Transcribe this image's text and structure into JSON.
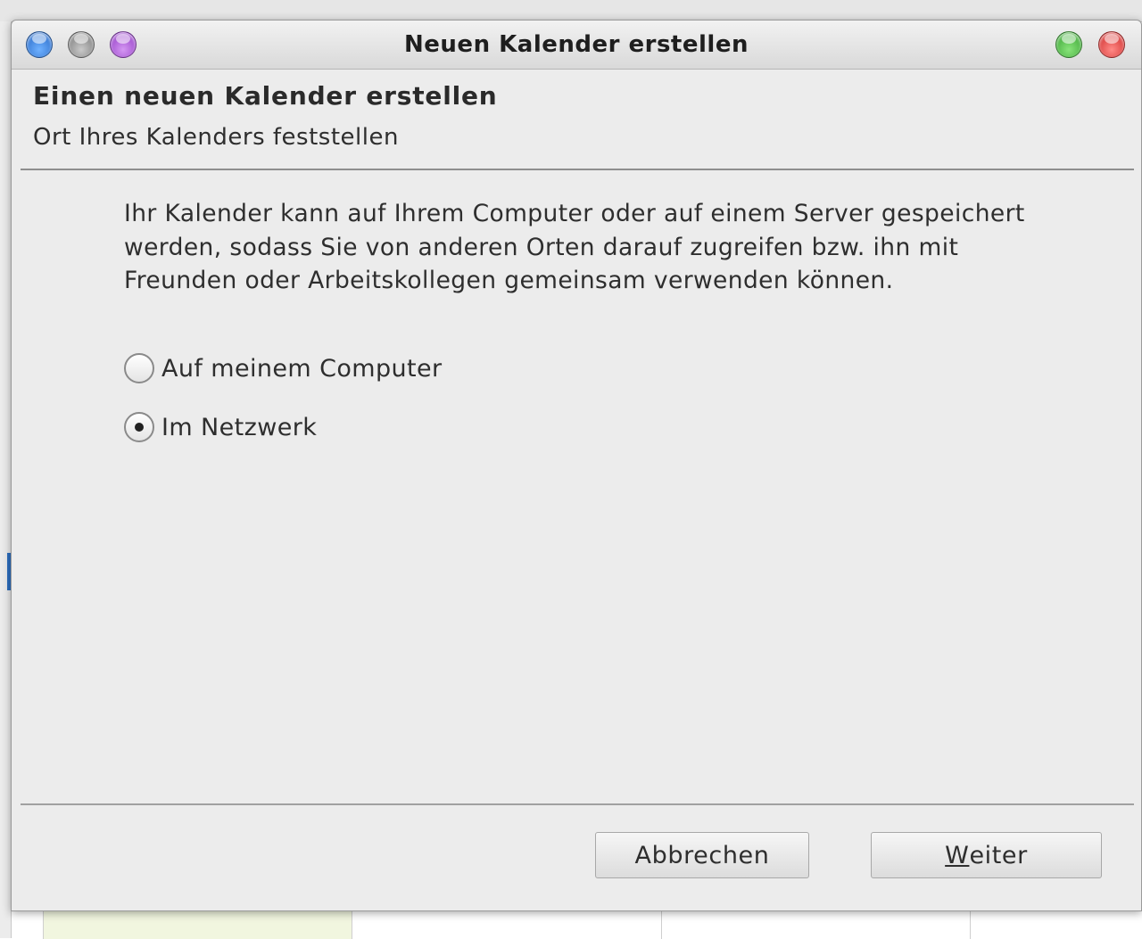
{
  "dialog": {
    "title": "Neuen Kalender erstellen",
    "header_title": "Einen neuen Kalender erstellen",
    "header_subtitle": "Ort Ihres Kalenders feststellen",
    "description": "Ihr Kalender kann auf Ihrem Computer oder auf einem Server gespeichert werden, sodass Sie von anderen Orten darauf zugreifen bzw. ihn mit Freunden oder Arbeitskollegen gemeinsam verwenden können.",
    "options": [
      {
        "label": "Auf meinem Computer",
        "checked": false
      },
      {
        "label": "Im Netzwerk",
        "checked": true
      }
    ],
    "buttons": {
      "cancel_label": "Abbrechen",
      "next_mnemonic": "W",
      "next_rest": "eiter"
    }
  },
  "window_buttons": {
    "left": [
      "blue",
      "gray",
      "purple"
    ],
    "right": [
      "green",
      "red"
    ]
  },
  "colors": {
    "dialog_bg": "#ececec",
    "title_text": "#1e1e1e",
    "accent_blue": "#2d6fc0"
  }
}
